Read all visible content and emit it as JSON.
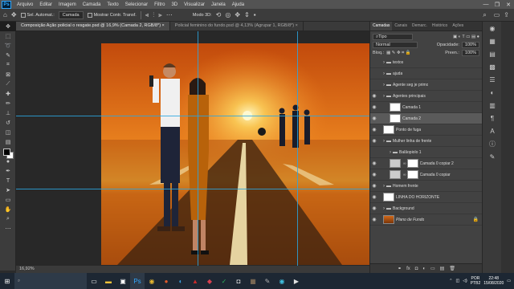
{
  "app": {
    "logo": "Ps"
  },
  "menu": [
    "Arquivo",
    "Editar",
    "Imagem",
    "Camada",
    "Texto",
    "Selecionar",
    "Filtro",
    "3D",
    "Visualizar",
    "Janela",
    "Ajuda"
  ],
  "window_controls": [
    "—",
    "❐",
    "✕"
  ],
  "options": {
    "auto_select_label": "Sel. Automat.:",
    "auto_select_value": "Camada",
    "transform_label": "Mostrar Contr. Transf.",
    "mode_3d": "Modo 3D:"
  },
  "tabs": [
    {
      "label": "Composição Ação policial o resgate.psd @ 16,9% (Camada 2, RGB/8*) ×",
      "active": true
    },
    {
      "label": "Policial feminino do fundo.psd @ 4,13% (Agrupar 1, RGB/8*) ×",
      "active": false
    }
  ],
  "status": {
    "zoom": "16,92%"
  },
  "layers_panel": {
    "tabs": [
      "Camadas",
      "Canais",
      "Demarc.",
      "Histórico",
      "Ações"
    ],
    "kind": "Tipo",
    "blend": "Normal",
    "opacity_label": "Opacidade:",
    "opacity": "100%",
    "lock_label": "Bloq.:",
    "fill_label": "Preen.:",
    "fill": "100%",
    "layers": [
      {
        "name": "textos",
        "type": "group",
        "indent": 0,
        "visible": false
      },
      {
        "name": "ajuda",
        "type": "group",
        "indent": 0,
        "visible": false
      },
      {
        "name": "Agente seg je primo",
        "type": "group",
        "indent": 0,
        "visible": false
      },
      {
        "name": "Agentes principais",
        "type": "group",
        "indent": 0,
        "visible": true
      },
      {
        "name": "Camada 1",
        "type": "layer",
        "indent": 1,
        "visible": true
      },
      {
        "name": "Camada 2",
        "type": "layer",
        "indent": 1,
        "visible": true,
        "selected": true
      },
      {
        "name": "Ponto de fuga",
        "type": "layer",
        "indent": 0,
        "visible": true
      },
      {
        "name": "Mulher linha de frente",
        "type": "group",
        "indent": 0,
        "visible": true
      },
      {
        "name": "Balãopiolo 1",
        "type": "group",
        "indent": 1,
        "visible": false
      },
      {
        "name": "Camada 0 copiar 2",
        "type": "mask",
        "indent": 1,
        "visible": true
      },
      {
        "name": "Camada 0 copiar",
        "type": "mask",
        "indent": 1,
        "visible": true
      },
      {
        "name": "Homem frente",
        "type": "group",
        "indent": 0,
        "visible": true
      },
      {
        "name": "LINHA DO HORIZONTE",
        "type": "layer",
        "indent": 0,
        "visible": true
      },
      {
        "name": "Background",
        "type": "group",
        "indent": 0,
        "visible": true
      },
      {
        "name": "Plano de Fundo",
        "type": "bg",
        "indent": 0,
        "visible": true,
        "locked": true
      }
    ],
    "footer_icons": [
      "⚭",
      "fx",
      "◘",
      "◐",
      "▭",
      "▤",
      "🗑"
    ]
  },
  "taskbar": {
    "search_placeholder": "",
    "lang": "POR",
    "layout": "PTB2",
    "time": "22:48",
    "date": "15/08/2020"
  }
}
